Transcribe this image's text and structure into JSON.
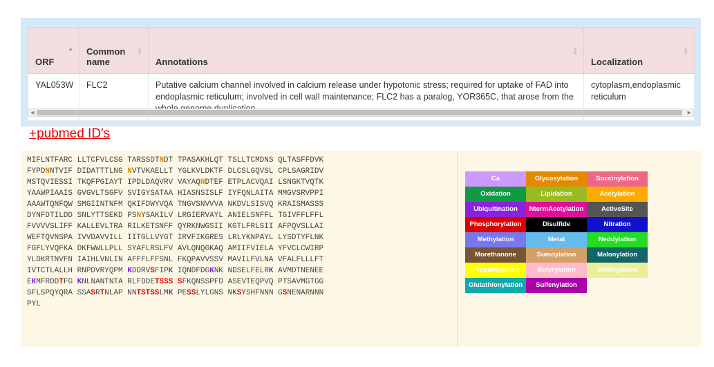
{
  "table": {
    "headers": [
      "ORF",
      "Common name",
      "Annotations",
      "Localization"
    ],
    "rows": [
      {
        "orf": "YAL053W",
        "common_name": "FLC2",
        "annotations": "Putative calcium channel involved in calcium release under hypotonic stress; required for uptake of FAD into endoplasmic reticulum; involved in cell wall maintenance; FLC2 has a paralog, YOR365C, that arose from the whole genome duplication",
        "localization": "cytoplasm,endoplasmic reticulum"
      }
    ]
  },
  "pubmed_link": "+pubmed ID's",
  "sequence_lines": [
    [
      {
        "t": "MIFLNTFARC LLTCFVLCSG TARSSDT"
      },
      {
        "t": "N",
        "c": "orange"
      },
      {
        "t": "DT TPASAKHLQT TSLLTCMDNS QLTASFFDVK"
      }
    ],
    [
      {
        "t": "FYPD"
      },
      {
        "t": "N",
        "c": "orange"
      },
      {
        "t": "NTVIF DIDATTTLNG "
      },
      {
        "t": "N",
        "c": "orange"
      },
      {
        "t": "VTVKAELLT YGLKVLDKTF DLCSLGQVSL CPLSAGRIDV"
      }
    ],
    [
      {
        "t": "MSTQVIESSI TKQFPGIAYT IPDLDAQVRV VAYAQ"
      },
      {
        "t": "N",
        "c": "orange"
      },
      {
        "t": "DTEF ETPLACVQAI LSNGKTVQTK"
      }
    ],
    [
      {
        "t": "YAAWPIAAIS GVGVLTSGFV SVIGYSATAA HIASNSISLF IYFQNLAITA MMGVSRVPPI"
      }
    ],
    [
      {
        "t": "AAAWTQNFQW SMGIINTNFM QKIFDWYVQA TNGVSNVVVA NKDVLSISVQ KRAISMASSS"
      }
    ],
    [
      {
        "t": "DYNFDTILDD SNLYTTSEKD PS"
      },
      {
        "t": "N",
        "c": "orange"
      },
      {
        "t": "YSAKILV LRGIERVAYL ANIELSNFFL TGIVFFLFFL"
      }
    ],
    [
      {
        "t": "FVVVVSLIFF KALLEVLTRA RILKETSNFF QYRKNWGSII KGTLFRLSII AFPQVSLLAI"
      }
    ],
    [
      {
        "t": "WEFTQVNSPA IVVDAVVILL IITGLLVYGT IRVFIKGRES LRLYKNPAYL LYSDTYFLNK"
      }
    ],
    [
      {
        "t": "FGFLYVQFKA DKFWWLLPLL SYAFLRSLFV AVLQNQGKAQ AMIIFVIELA YFVCLCWIRP"
      }
    ],
    [
      {
        "t": "YLDKRTNVFN IAIHLVNLIN AFFFLFFSNL FKQPAVVSSV MAVILFVLNA VFALFLLLFT"
      }
    ],
    [
      {
        "t": "IVTCTLALLH RNPDVRYQPM "
      },
      {
        "t": "K",
        "c": "purple"
      },
      {
        "t": "DDRV"
      },
      {
        "t": "S",
        "c": "red"
      },
      {
        "t": "FIP"
      },
      {
        "t": "K",
        "c": "purple"
      },
      {
        "t": " IQNDFDG"
      },
      {
        "t": "K",
        "c": "purple"
      },
      {
        "t": "NK NDSELFELR"
      },
      {
        "t": "K",
        "c": "purple"
      },
      {
        "t": " AVMDTNENEE"
      }
    ],
    [
      {
        "t": "E"
      },
      {
        "t": "K",
        "c": "purple"
      },
      {
        "t": "MFRDD"
      },
      {
        "t": "T",
        "c": "red"
      },
      {
        "t": "FG "
      },
      {
        "t": "K",
        "c": "purple"
      },
      {
        "t": "NLNANTNTA RLFDDE"
      },
      {
        "t": "TSSS",
        "c": "red"
      },
      {
        "t": " "
      },
      {
        "t": "S",
        "c": "red"
      },
      {
        "t": "FKQNSSPFD ASEVTEQPVQ PTSAVMGTGG"
      }
    ],
    [
      {
        "t": "SFLSPQYQRA SSA"
      },
      {
        "t": "S",
        "c": "red"
      },
      {
        "t": "R"
      },
      {
        "t": "T",
        "c": "red"
      },
      {
        "t": "NLAP NN"
      },
      {
        "t": "TSTSS",
        "c": "red"
      },
      {
        "t": "LM"
      },
      {
        "t": "K",
        "c": "purple"
      },
      {
        "t": " PE"
      },
      {
        "t": "SS",
        "c": "red"
      },
      {
        "t": "LYLGNS NK"
      },
      {
        "t": "S",
        "c": "red"
      },
      {
        "t": "YSHFNNN G"
      },
      {
        "t": "S",
        "c": "red"
      },
      {
        "t": "NENARNNN"
      }
    ],
    [
      {
        "t": "PYL"
      }
    ]
  ],
  "legend": [
    {
      "label": "Ca",
      "bg": "#cc99ff",
      "fg": "#ffffff"
    },
    {
      "label": "Glycosylation",
      "bg": "#e38a00",
      "fg": "#ffffff"
    },
    {
      "label": "Succinylation",
      "bg": "#ee6688",
      "fg": "#ffffff"
    },
    {
      "label": "Oxidation",
      "bg": "#119944",
      "fg": "#ffffff"
    },
    {
      "label": "Lipidation",
      "bg": "#99bb22",
      "fg": "#ffffff"
    },
    {
      "label": "Acetylation",
      "bg": "#ffaa00",
      "fg": "#ffffff"
    },
    {
      "label": "Ubiquitination",
      "bg": "#8822dd",
      "fg": "#ffffff"
    },
    {
      "label": "NtermAcetylation",
      "bg": "#dd1199",
      "fg": "#ffffff"
    },
    {
      "label": "ActiveSite",
      "bg": "#555555",
      "fg": "#ffffff"
    },
    {
      "label": "Phosphorylation",
      "bg": "#dd0000",
      "fg": "#ffffff"
    },
    {
      "label": "Disulfide",
      "bg": "#000000",
      "fg": "#ffffff"
    },
    {
      "label": "Nitration",
      "bg": "#1111cc",
      "fg": "#ffffff"
    },
    {
      "label": "Methylation",
      "bg": "#7777ee",
      "fg": "#ffffff"
    },
    {
      "label": "Metal",
      "bg": "#66bbee",
      "fg": "#ffffff"
    },
    {
      "label": "Neddylation",
      "bg": "#22dd22",
      "fg": "#ffffff"
    },
    {
      "label": "Morethanone",
      "bg": "#775533",
      "fg": "#ffffff"
    },
    {
      "label": "Sumoylation",
      "bg": "#d4a06a",
      "fg": "#ffffff"
    },
    {
      "label": "Malonylation",
      "bg": "#116666",
      "fg": "#ffffff"
    },
    {
      "label": "Propionylation",
      "bg": "#ffff00",
      "fg": "#ffffff"
    },
    {
      "label": "Butyrylation",
      "bg": "#ffbbcc",
      "fg": "#ffffff"
    },
    {
      "label": "Biotinylation",
      "bg": "#eeee99",
      "fg": "#ffffff"
    },
    {
      "label": "Glutathionylation",
      "bg": "#11aaaa",
      "fg": "#ffffff"
    },
    {
      "label": "Sulfenylation",
      "bg": "#aa00aa",
      "fg": "#ffffff"
    }
  ]
}
